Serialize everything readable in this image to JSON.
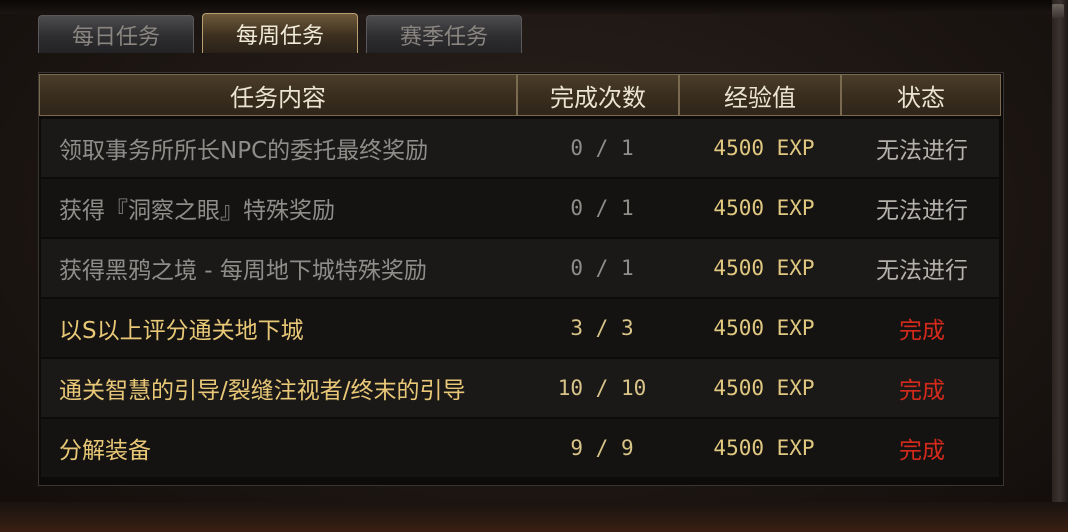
{
  "tabs": [
    {
      "label": "每日任务",
      "active": false
    },
    {
      "label": "每周任务",
      "active": true
    },
    {
      "label": "赛季任务",
      "active": false
    }
  ],
  "table": {
    "headers": {
      "task": "任务内容",
      "count": "完成次数",
      "exp": "经验值",
      "status": "状态"
    },
    "rows": [
      {
        "task": "领取事务所所长NPC的委托最终奖励",
        "count": "0 / 1",
        "exp": "4500 EXP",
        "status": "无法进行"
      },
      {
        "task": "获得『洞察之眼』特殊奖励",
        "count": "0 / 1",
        "exp": "4500 EXP",
        "status": "无法进行"
      },
      {
        "task": "获得黑鸦之境 - 每周地下城特殊奖励",
        "count": "0 / 1",
        "exp": "4500 EXP",
        "status": "无法进行"
      },
      {
        "task": "以S以上评分通关地下城",
        "count": "3 / 3",
        "exp": "4500 EXP",
        "status": "完成"
      },
      {
        "task": "通关智慧的引导/裂缝注视者/终末的引导",
        "count": "10 / 10",
        "exp": "4500 EXP",
        "status": "完成"
      },
      {
        "task": "分解装备",
        "count": "9 / 9",
        "exp": "4500 EXP",
        "status": "完成"
      }
    ]
  },
  "colors": {
    "completed_text": "#e8c877",
    "status_done": "#d42a1c",
    "status_blocked": "#b4b0aa"
  }
}
